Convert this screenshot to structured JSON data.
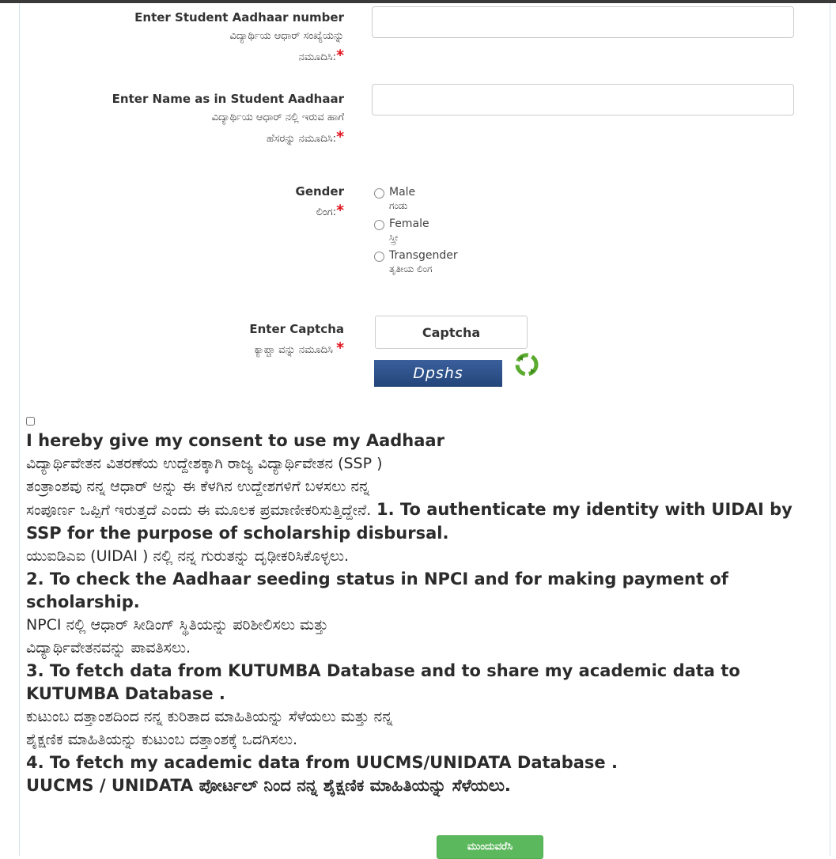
{
  "form": {
    "aadhaar": {
      "label_en": "Enter Student Aadhaar number",
      "label_kn1": "ವಿದ್ಯಾರ್ಥಿಯ ಆಧಾರ್ ಸಂಖ್ಯೆಯನ್ನು",
      "label_kn2": "ನಮೂದಿಸಿ:",
      "required": "*",
      "value": ""
    },
    "name": {
      "label_en": "Enter Name as in Student Aadhaar",
      "label_kn1": "ವಿದ್ಯಾರ್ಥಿಯ ಆಧಾರ್ ನಲ್ಲಿ ಇರುವ ಹಾಗೆ",
      "label_kn2": "ಹೆಸರನ್ನು ನಮೂದಿಸಿ:",
      "required": "*",
      "value": ""
    },
    "gender": {
      "label_en": "Gender",
      "label_kn": "ಲಿಂಗ:",
      "required": "*",
      "options": [
        {
          "en": "Male",
          "kn": "ಗಂಡು"
        },
        {
          "en": "Female",
          "kn": "ಸ್ತ್ರೀ"
        },
        {
          "en": "Transgender",
          "kn": "ತೃತೀಯ ಲಿಂಗ"
        }
      ]
    },
    "captcha": {
      "label_en": "Enter Captcha",
      "label_kn": "ಕ್ಯಾಪ್ಚಾ ವನ್ನು ನಮೂದಿಸಿ",
      "required": "*",
      "placeholder": "Captcha",
      "image_text": "Dpshs",
      "refresh_icon": "refresh-icon"
    }
  },
  "consent": {
    "checked": false,
    "lines": [
      "I hereby give my consent to use my Aadhaar",
      "ವಿದ್ಯಾರ್ಥಿವೇತನ ವಿತರಣೆಯ ಉದ್ದೇಶಕ್ಕಾಗಿ ರಾಜ್ಯ ವಿದ್ಯಾರ್ಥಿವೇತನ (SSP )",
      "ತಂತ್ರಾಂಶವು ನನ್ನ ಆಧಾರ್ ಅನ್ನು ಈ ಕೆಳಗಿನ ಉದ್ದೇಶಗಳಿಗೆ ಬಳಸಲು ನನ್ನ",
      "ಸಂಪೂರ್ಣ ಒಪ್ಪಿಗೆ ಇರುತ್ತದೆ ಎಂದು ಈ ಮೂಲಕ ಪ್ರಮಾಣೀಕರಿಸುತ್ತಿದ್ದೇನೆ.",
      "1. To authenticate my identity with UIDAI by SSP for the purpose of scholarship disbursal.",
      "ಯುಐಡಿಎಐ (UIDAI ) ನಲ್ಲಿ ನನ್ನ ಗುರುತನ್ನು ದೃಢೀಕರಿಸಿಕೊಳ್ಳಲು.",
      "2. To check the Aadhaar seeding status in NPCI and for making payment of scholarship.",
      "NPCI ನಲ್ಲಿ ಆಧಾರ್ ಸೀಡಿಂಗ್ ಸ್ಥಿತಿಯನ್ನು ಪರಿಶೀಲಿಸಲು ಮತ್ತು",
      "ವಿದ್ಯಾರ್ಥಿವೇತನವನ್ನು ಪಾವತಿಸಲು.",
      "3. To fetch data from KUTUMBA Database and to share my academic data to KUTUMBA Database .",
      "ಕುಟುಂಬ ದತ್ತಾಂಶದಿಂದ ನನ್ನ ಕುರಿತಾದ ಮಾಹಿತಿಯನ್ನು ಸೆಳೆಯಲು ಮತ್ತು ನನ್ನ",
      "ಶೈಕ್ಷಣಿಕ ಮಾಹಿತಿಯನ್ನು ಕುಟುಂಬ ದತ್ತಾಂಶಕ್ಕೆ ಒದಗಿಸಲು.",
      "4. To fetch my academic data from UUCMS/UNIDATA Database .",
      "UUCMS / UNIDATA ಪೋರ್ಟಲ್ ನಿಂದ ನನ್ನ ಶೈಕ್ಷಣಿಕ ಮಾಹಿತಿಯನ್ನು ಸೆಳೆಯಲು."
    ]
  },
  "submit": {
    "label": "ಮುಂದುವರೆಸಿ",
    "color": "#5cb85c"
  },
  "colors": {
    "required": "#e0141e",
    "accent": "#5cb85c",
    "captcha_bg": "#2d4f8a"
  }
}
